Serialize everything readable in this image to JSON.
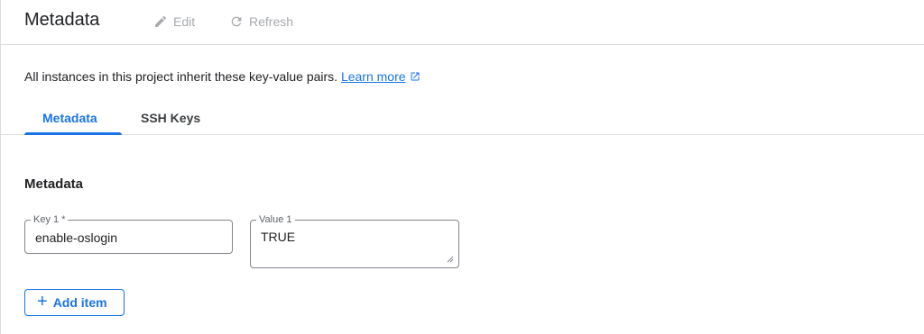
{
  "header": {
    "title": "Metadata",
    "edit_label": "Edit",
    "refresh_label": "Refresh"
  },
  "description": {
    "text": "All instances in this project inherit these key-value pairs.",
    "link_label": "Learn more"
  },
  "tabs": [
    {
      "label": "Metadata",
      "active": true
    },
    {
      "label": "SSH Keys",
      "active": false
    }
  ],
  "section": {
    "title": "Metadata"
  },
  "items": [
    {
      "key_label": "Key 1 *",
      "key_value": "enable-oslogin",
      "value_label": "Value 1",
      "value_value": "TRUE"
    }
  ],
  "add_button": {
    "icon": "+",
    "label": "Add item"
  },
  "colors": {
    "accent": "#1a73e8",
    "disabled": "#a6a9ad",
    "border": "#dadce0"
  }
}
